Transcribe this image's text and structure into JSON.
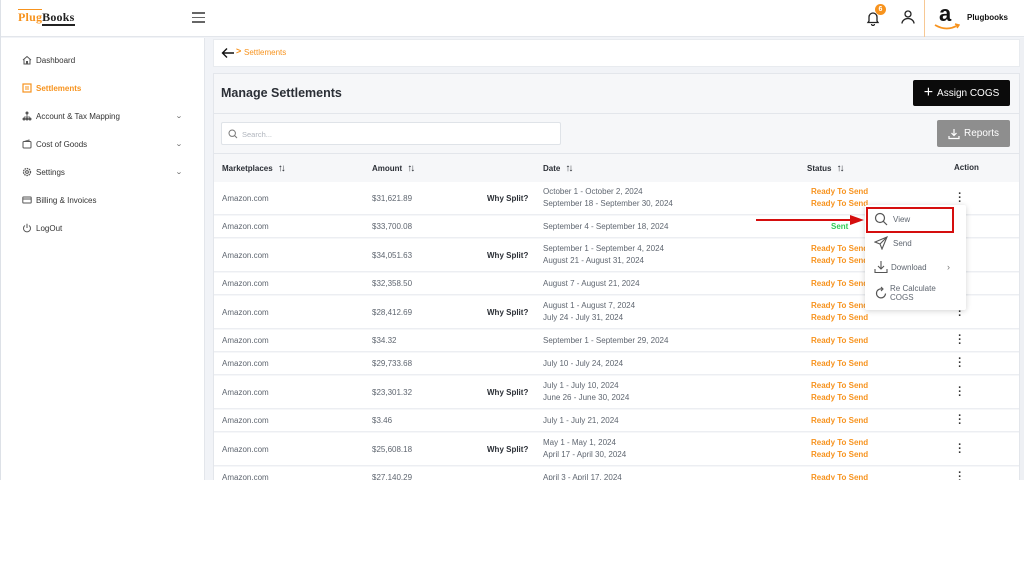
{
  "brand": {
    "logo_part1": "Plug",
    "logo_part2": "Books",
    "accent": "#f7931e"
  },
  "topbar": {
    "notification_count": "6",
    "store_name": "Plugbooks",
    "icons": [
      "menu-icon",
      "bell-icon",
      "user-icon",
      "amazon-logo"
    ]
  },
  "sidebar": {
    "items": [
      {
        "label": "Dashboard",
        "icon": "home-icon",
        "active": false,
        "expandable": false
      },
      {
        "label": "Settlements",
        "icon": "settlements-icon",
        "active": true,
        "expandable": false
      },
      {
        "label": "Account & Tax Mapping",
        "icon": "hierarchy-icon",
        "active": false,
        "expandable": true
      },
      {
        "label": "Cost of Goods",
        "icon": "wallet-icon",
        "active": false,
        "expandable": true
      },
      {
        "label": "Settings",
        "icon": "gear-icon",
        "active": false,
        "expandable": true
      },
      {
        "label": "Billing & Invoices",
        "icon": "card-icon",
        "active": false,
        "expandable": false
      },
      {
        "label": "LogOut",
        "icon": "power-icon",
        "active": false,
        "expandable": false
      }
    ]
  },
  "breadcrumb": {
    "separator": ">",
    "current": "Settlements"
  },
  "main": {
    "title": "Manage Settlements",
    "assign_button": "Assign COGS",
    "reports_button": "Reports",
    "search_placeholder": "Search...",
    "columns": [
      "Marketplaces",
      "Amount",
      "Date",
      "Status",
      "Action"
    ],
    "why_split_label": "Why Split?",
    "rows": [
      {
        "marketplace": "Amazon.com",
        "amount": "$31,621.89",
        "split": true,
        "dates": [
          "October 1 - October 2, 2024",
          "September 18 - September 30, 2024"
        ],
        "status": [
          "Ready To Send",
          "Ready To Send"
        ]
      },
      {
        "marketplace": "Amazon.com",
        "amount": "$33,700.08",
        "split": false,
        "dates": [
          "September 4 - September 18, 2024"
        ],
        "status": [
          "Sent"
        ]
      },
      {
        "marketplace": "Amazon.com",
        "amount": "$34,051.63",
        "split": true,
        "dates": [
          "September 1 - September 4, 2024",
          "August 21 - August 31, 2024"
        ],
        "status": [
          "Ready To Send",
          "Ready To Send"
        ]
      },
      {
        "marketplace": "Amazon.com",
        "amount": "$32,358.50",
        "split": false,
        "dates": [
          "August 7 - August 21, 2024"
        ],
        "status": [
          "Ready To Send"
        ]
      },
      {
        "marketplace": "Amazon.com",
        "amount": "$28,412.69",
        "split": true,
        "dates": [
          "August 1 - August 7, 2024",
          "July 24 - July 31, 2024"
        ],
        "status": [
          "Ready To Send",
          "Ready To Send"
        ]
      },
      {
        "marketplace": "Amazon.com",
        "amount": "$34.32",
        "split": false,
        "dates": [
          "September 1 - September 29, 2024"
        ],
        "status": [
          "Ready To Send"
        ]
      },
      {
        "marketplace": "Amazon.com",
        "amount": "$29,733.68",
        "split": false,
        "dates": [
          "July 10 - July 24, 2024"
        ],
        "status": [
          "Ready To Send"
        ]
      },
      {
        "marketplace": "Amazon.com",
        "amount": "$23,301.32",
        "split": true,
        "dates": [
          "July 1 - July 10, 2024",
          "June 26 - June 30, 2024"
        ],
        "status": [
          "Ready To Send",
          "Ready To Send"
        ]
      },
      {
        "marketplace": "Amazon.com",
        "amount": "$3.46",
        "split": false,
        "dates": [
          "July 1 - July 21, 2024"
        ],
        "status": [
          "Ready To Send"
        ]
      },
      {
        "marketplace": "Amazon.com",
        "amount": "$25,608.18",
        "split": true,
        "dates": [
          "May 1 - May 1, 2024",
          "April 17 - April 30, 2024"
        ],
        "status": [
          "Ready To Send",
          "Ready To Send"
        ]
      },
      {
        "marketplace": "Amazon.com",
        "amount": "$27,140.29",
        "split": false,
        "dates": [
          "April 3 - April 17, 2024"
        ],
        "status": [
          "Ready To Send"
        ]
      }
    ]
  },
  "action_menu": {
    "items": [
      {
        "label": "View",
        "icon": "search-icon",
        "highlighted": true
      },
      {
        "label": "Send",
        "icon": "send-icon"
      },
      {
        "label": "Download",
        "icon": "download-icon",
        "submenu": true
      },
      {
        "label": "Re Calculate",
        "label2": "COGS",
        "icon": "refresh-icon"
      }
    ]
  },
  "colors": {
    "ready": "#f7931e",
    "sent": "#2ecc55",
    "highlight": "#d50e0e",
    "primary_btn": "#0b0b0b",
    "disabled_btn": "#8e8e8e"
  }
}
